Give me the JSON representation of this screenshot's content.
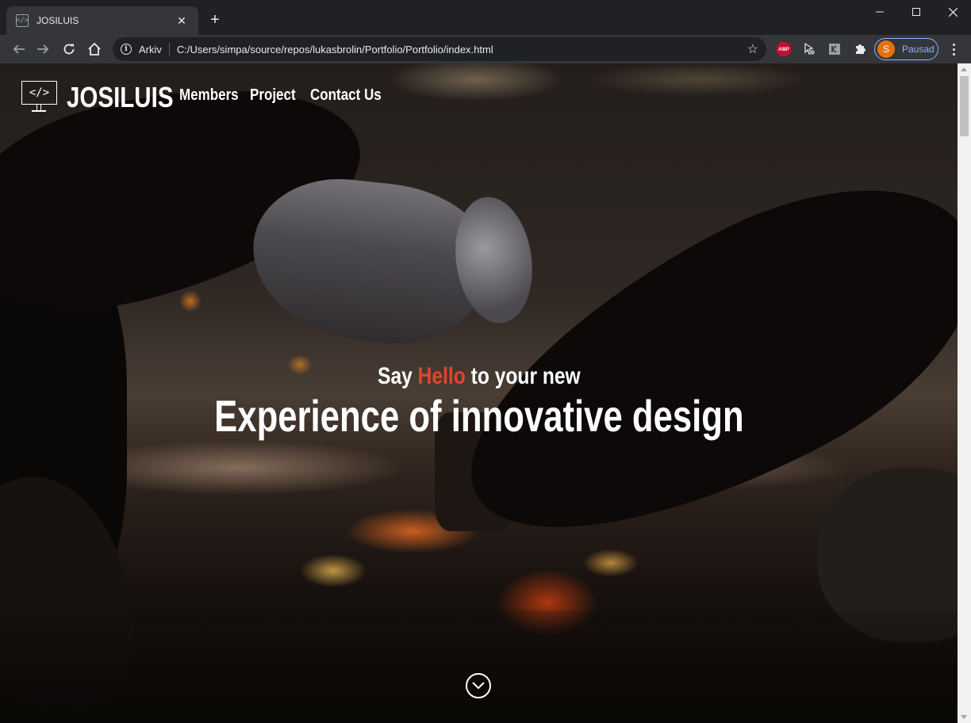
{
  "browser": {
    "tab": {
      "title": "JOSILUIS",
      "favicon": "code-file-icon"
    },
    "new_tab_symbol": "+",
    "omnibox": {
      "security_label": "Arkiv",
      "url": "C:/Users/simpa/source/repos/lukasbrolin/Portfolio/Portfolio/index.html"
    },
    "extensions": [
      {
        "name": "adblock-plus-icon",
        "label": "ABP"
      },
      {
        "name": "cursor-extension-icon"
      },
      {
        "name": "translate-extension-icon"
      },
      {
        "name": "puzzle-extensions-icon"
      }
    ],
    "profile": {
      "initial": "S",
      "label": "Pausad"
    }
  },
  "site": {
    "brand": "JOSILUIS",
    "logo_text": "</>",
    "nav": [
      {
        "label": "Members"
      },
      {
        "label": "Project"
      },
      {
        "label": "Contact Us"
      }
    ],
    "hero": {
      "sub_before": "Say ",
      "sub_highlight": "Hello",
      "sub_after": " to your new",
      "title": "Experience of innovative design"
    }
  },
  "colors": {
    "accent": "#e0452b",
    "chrome_dark": "#202124",
    "chrome_toolbar": "#35363a",
    "profile_accent": "#8ab4f8",
    "avatar": "#e8710a"
  }
}
